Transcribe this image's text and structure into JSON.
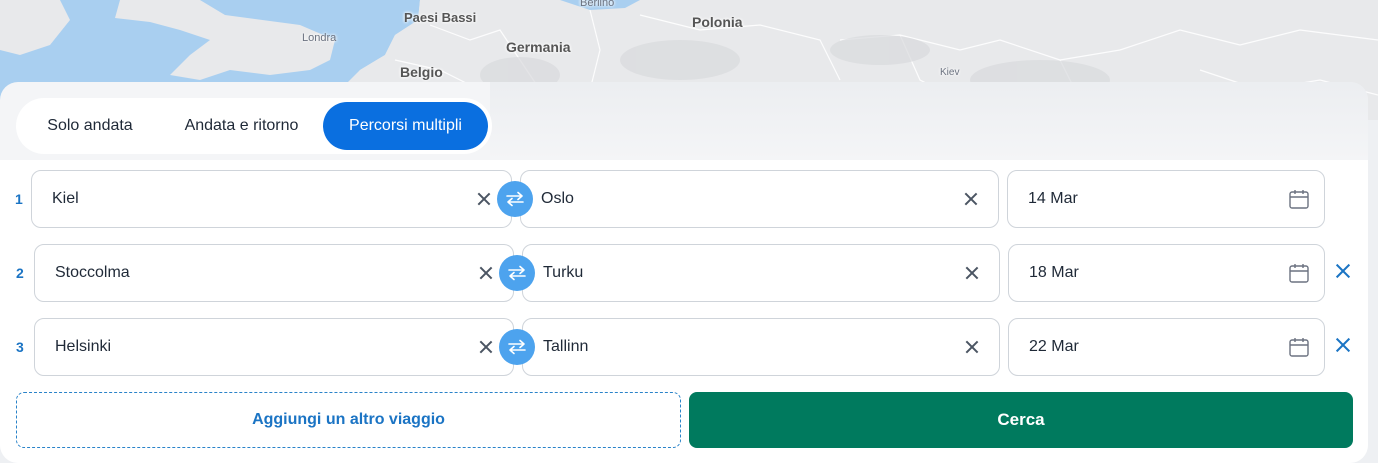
{
  "map": {
    "labels": {
      "paesi_bassi": "Paesi Bassi",
      "berlino": "Berlino",
      "polonia": "Polonia",
      "londra": "Londra",
      "germania": "Germania",
      "belgio": "Belgio",
      "kiev": "Kiev"
    },
    "colors": {
      "sea": "#a9cff0",
      "land": "#e8e9eb",
      "border": "#ffffff"
    }
  },
  "trip_types": {
    "one_way": "Solo andata",
    "round_trip": "Andata e ritorno",
    "multi_city": "Percorsi multipli",
    "selected": "Percorsi multipli"
  },
  "legs": [
    {
      "number": "1",
      "from": "Kiel",
      "to": "Oslo",
      "date": "14 Mar"
    },
    {
      "number": "2",
      "from": "Stoccolma",
      "to": "Turku",
      "date": "18 Mar"
    },
    {
      "number": "3",
      "from": "Helsinki",
      "to": "Tallinn",
      "date": "22 Mar"
    }
  ],
  "actions": {
    "add_trip": "Aggiungi un altro viaggio",
    "search": "Cerca"
  },
  "colors": {
    "accent_blue": "#0a6fe0",
    "swap_blue": "#4da3ee",
    "link_blue": "#1b74c4",
    "search_green": "#007a5e"
  },
  "icons": {
    "clear": "close-icon",
    "swap": "swap-arrows-icon",
    "date": "calendar-icon",
    "remove": "remove-leg-icon"
  }
}
